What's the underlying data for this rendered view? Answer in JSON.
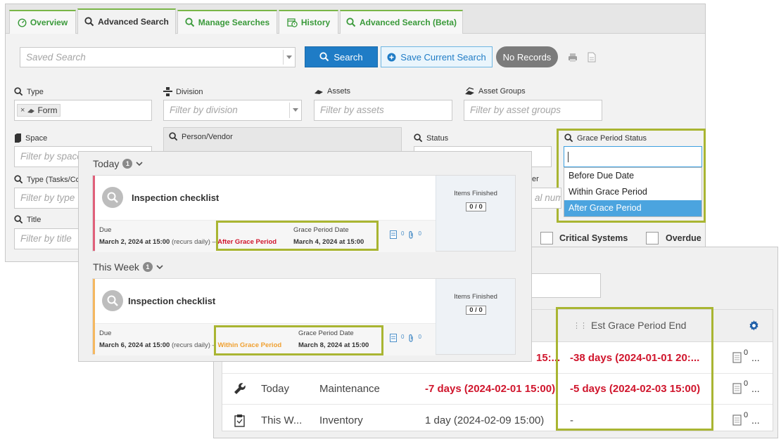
{
  "tabs": [
    {
      "label": "Overview",
      "icon": "gauge-icon"
    },
    {
      "label": "Advanced Search",
      "icon": "search-icon"
    },
    {
      "label": "Manage Searches",
      "icon": "search-icon"
    },
    {
      "label": "History",
      "icon": "history-calendar-icon"
    },
    {
      "label": "Advanced Search (Beta)",
      "icon": "search-icon"
    }
  ],
  "toolbar": {
    "saved_search_placeholder": "Saved Search",
    "search_label": "Search",
    "save_current_label": "Save Current Search",
    "no_records_label": "No Records"
  },
  "filters": {
    "type_label": "Type",
    "type_chip": "Form",
    "division_label": "Division",
    "division_placeholder": "Filter by division",
    "assets_label": "Assets",
    "assets_placeholder": "Filter by assets",
    "asset_groups_label": "Asset Groups",
    "asset_groups_placeholder": "Filter by asset groups",
    "space_label": "Space",
    "space_placeholder": "Filter by space",
    "person_label": "Person/Vendor",
    "status_label": "Status",
    "grace_label": "Grace Period Status",
    "type_tasks_label": "Type (Tasks/Co",
    "type_tasks_placeholder": "Filter by type",
    "title_label": "Title",
    "title_placeholder": "Filter by title",
    "serial_label_partial": "er",
    "serial_placeholder_partial": "al numb",
    "critical_label": "Critical Systems",
    "overdue_label": "Overdue"
  },
  "grace_options": [
    "Before Due Date",
    "Within Grace Period",
    "After Grace Period"
  ],
  "grace_selected_index": 2,
  "list_panel": {
    "sections": [
      {
        "title": "Today",
        "count": "1",
        "card": {
          "title": "Inspection checklist",
          "due_label": "Due",
          "due_value": "March 2, 2024 at 15:00",
          "recurs": "(recurs daily)",
          "separator": "–",
          "grace_status": "After Grace Period",
          "grace_status_color": "#d0162d",
          "accent_color": "#e0607a",
          "grace_date_label": "Grace Period Date",
          "grace_date_value": "March 4, 2024 at 15:00",
          "notes_count": "0",
          "attach_count": "0",
          "items_finished_label": "Items Finished",
          "items_finished_value": "0 / 0"
        }
      },
      {
        "title": "This Week",
        "count": "1",
        "card": {
          "title": "Inspection checklist",
          "due_label": "Due",
          "due_value": "March 6, 2024 at 15:00",
          "recurs": "(recurs daily)",
          "separator": "–",
          "grace_status": "Within Grace Period",
          "grace_status_color": "#f0a030",
          "accent_color": "#f5b860",
          "grace_date_label": "Grace Period Date",
          "grace_date_value": "March 8, 2024 at 15:00",
          "notes_count": "0",
          "attach_count": "0",
          "items_finished_label": "Items Finished",
          "items_finished_value": "0 / 0"
        }
      }
    ]
  },
  "results_table": {
    "header_est_grace": "Est Grace Period End",
    "rows": [
      {
        "icon": "",
        "when": "",
        "type": "",
        "due": "15:...",
        "due_red": true,
        "grace_end": "-38 days (2024-01-01 20:...",
        "grace_red": true,
        "notes": "0",
        "more": "..."
      },
      {
        "icon": "wrench-icon",
        "when": "Today",
        "type": "Maintenance",
        "due": "-7 days (2024-02-01 15:00)",
        "due_red": true,
        "grace_end": "-5 days (2024-02-03 15:00)",
        "grace_red": true,
        "notes": "0",
        "more": "..."
      },
      {
        "icon": "clipboard-icon",
        "when": "This W...",
        "type": "Inventory",
        "due": "1 day (2024-02-09 15:00)",
        "due_red": false,
        "grace_end": "-",
        "grace_red": false,
        "notes": "0",
        "more": "..."
      }
    ]
  },
  "colors": {
    "accent_green": "#7ab648",
    "highlight_olive": "#a9b532",
    "primary_blue": "#1f7cc6",
    "danger_red": "#d0162d",
    "warning_orange": "#f0a030"
  }
}
